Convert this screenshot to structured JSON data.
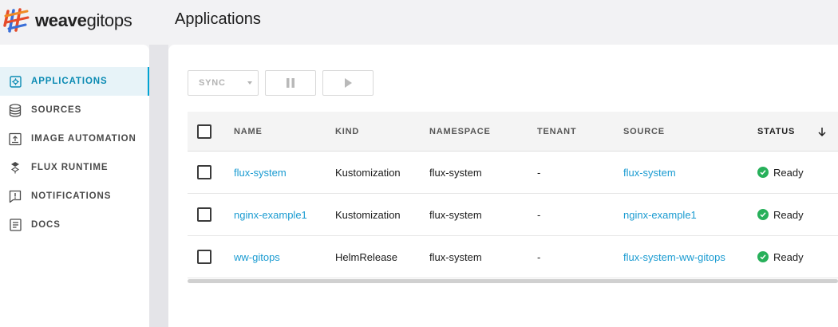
{
  "brand": {
    "part1": "weave",
    "part2": "gitops"
  },
  "page": {
    "title": "Applications"
  },
  "sidebar": {
    "items": [
      {
        "label": "APPLICATIONS",
        "icon": "applications-icon",
        "active": true
      },
      {
        "label": "SOURCES",
        "icon": "sources-icon",
        "active": false
      },
      {
        "label": "IMAGE AUTOMATION",
        "icon": "image-automation-icon",
        "active": false
      },
      {
        "label": "FLUX RUNTIME",
        "icon": "flux-runtime-icon",
        "active": false
      },
      {
        "label": "NOTIFICATIONS",
        "icon": "notifications-icon",
        "active": false
      },
      {
        "label": "DOCS",
        "icon": "docs-icon",
        "active": false
      }
    ]
  },
  "toolbar": {
    "sync_label": "SYNC"
  },
  "table": {
    "columns": [
      "NAME",
      "KIND",
      "NAMESPACE",
      "TENANT",
      "SOURCE",
      "STATUS"
    ],
    "rows": [
      {
        "name": "flux-system",
        "kind": "Kustomization",
        "namespace": "flux-system",
        "tenant": "-",
        "source": "flux-system",
        "status": "Ready"
      },
      {
        "name": "nginx-example1",
        "kind": "Kustomization",
        "namespace": "flux-system",
        "tenant": "-",
        "source": "nginx-example1",
        "status": "Ready"
      },
      {
        "name": "ww-gitops",
        "kind": "HelmRelease",
        "namespace": "flux-system",
        "tenant": "-",
        "source": "flux-system-ww-gitops",
        "status": "Ready"
      }
    ]
  },
  "colors": {
    "accent": "#00a3d3",
    "link": "#1a9bd1",
    "ready": "#27b05a"
  }
}
